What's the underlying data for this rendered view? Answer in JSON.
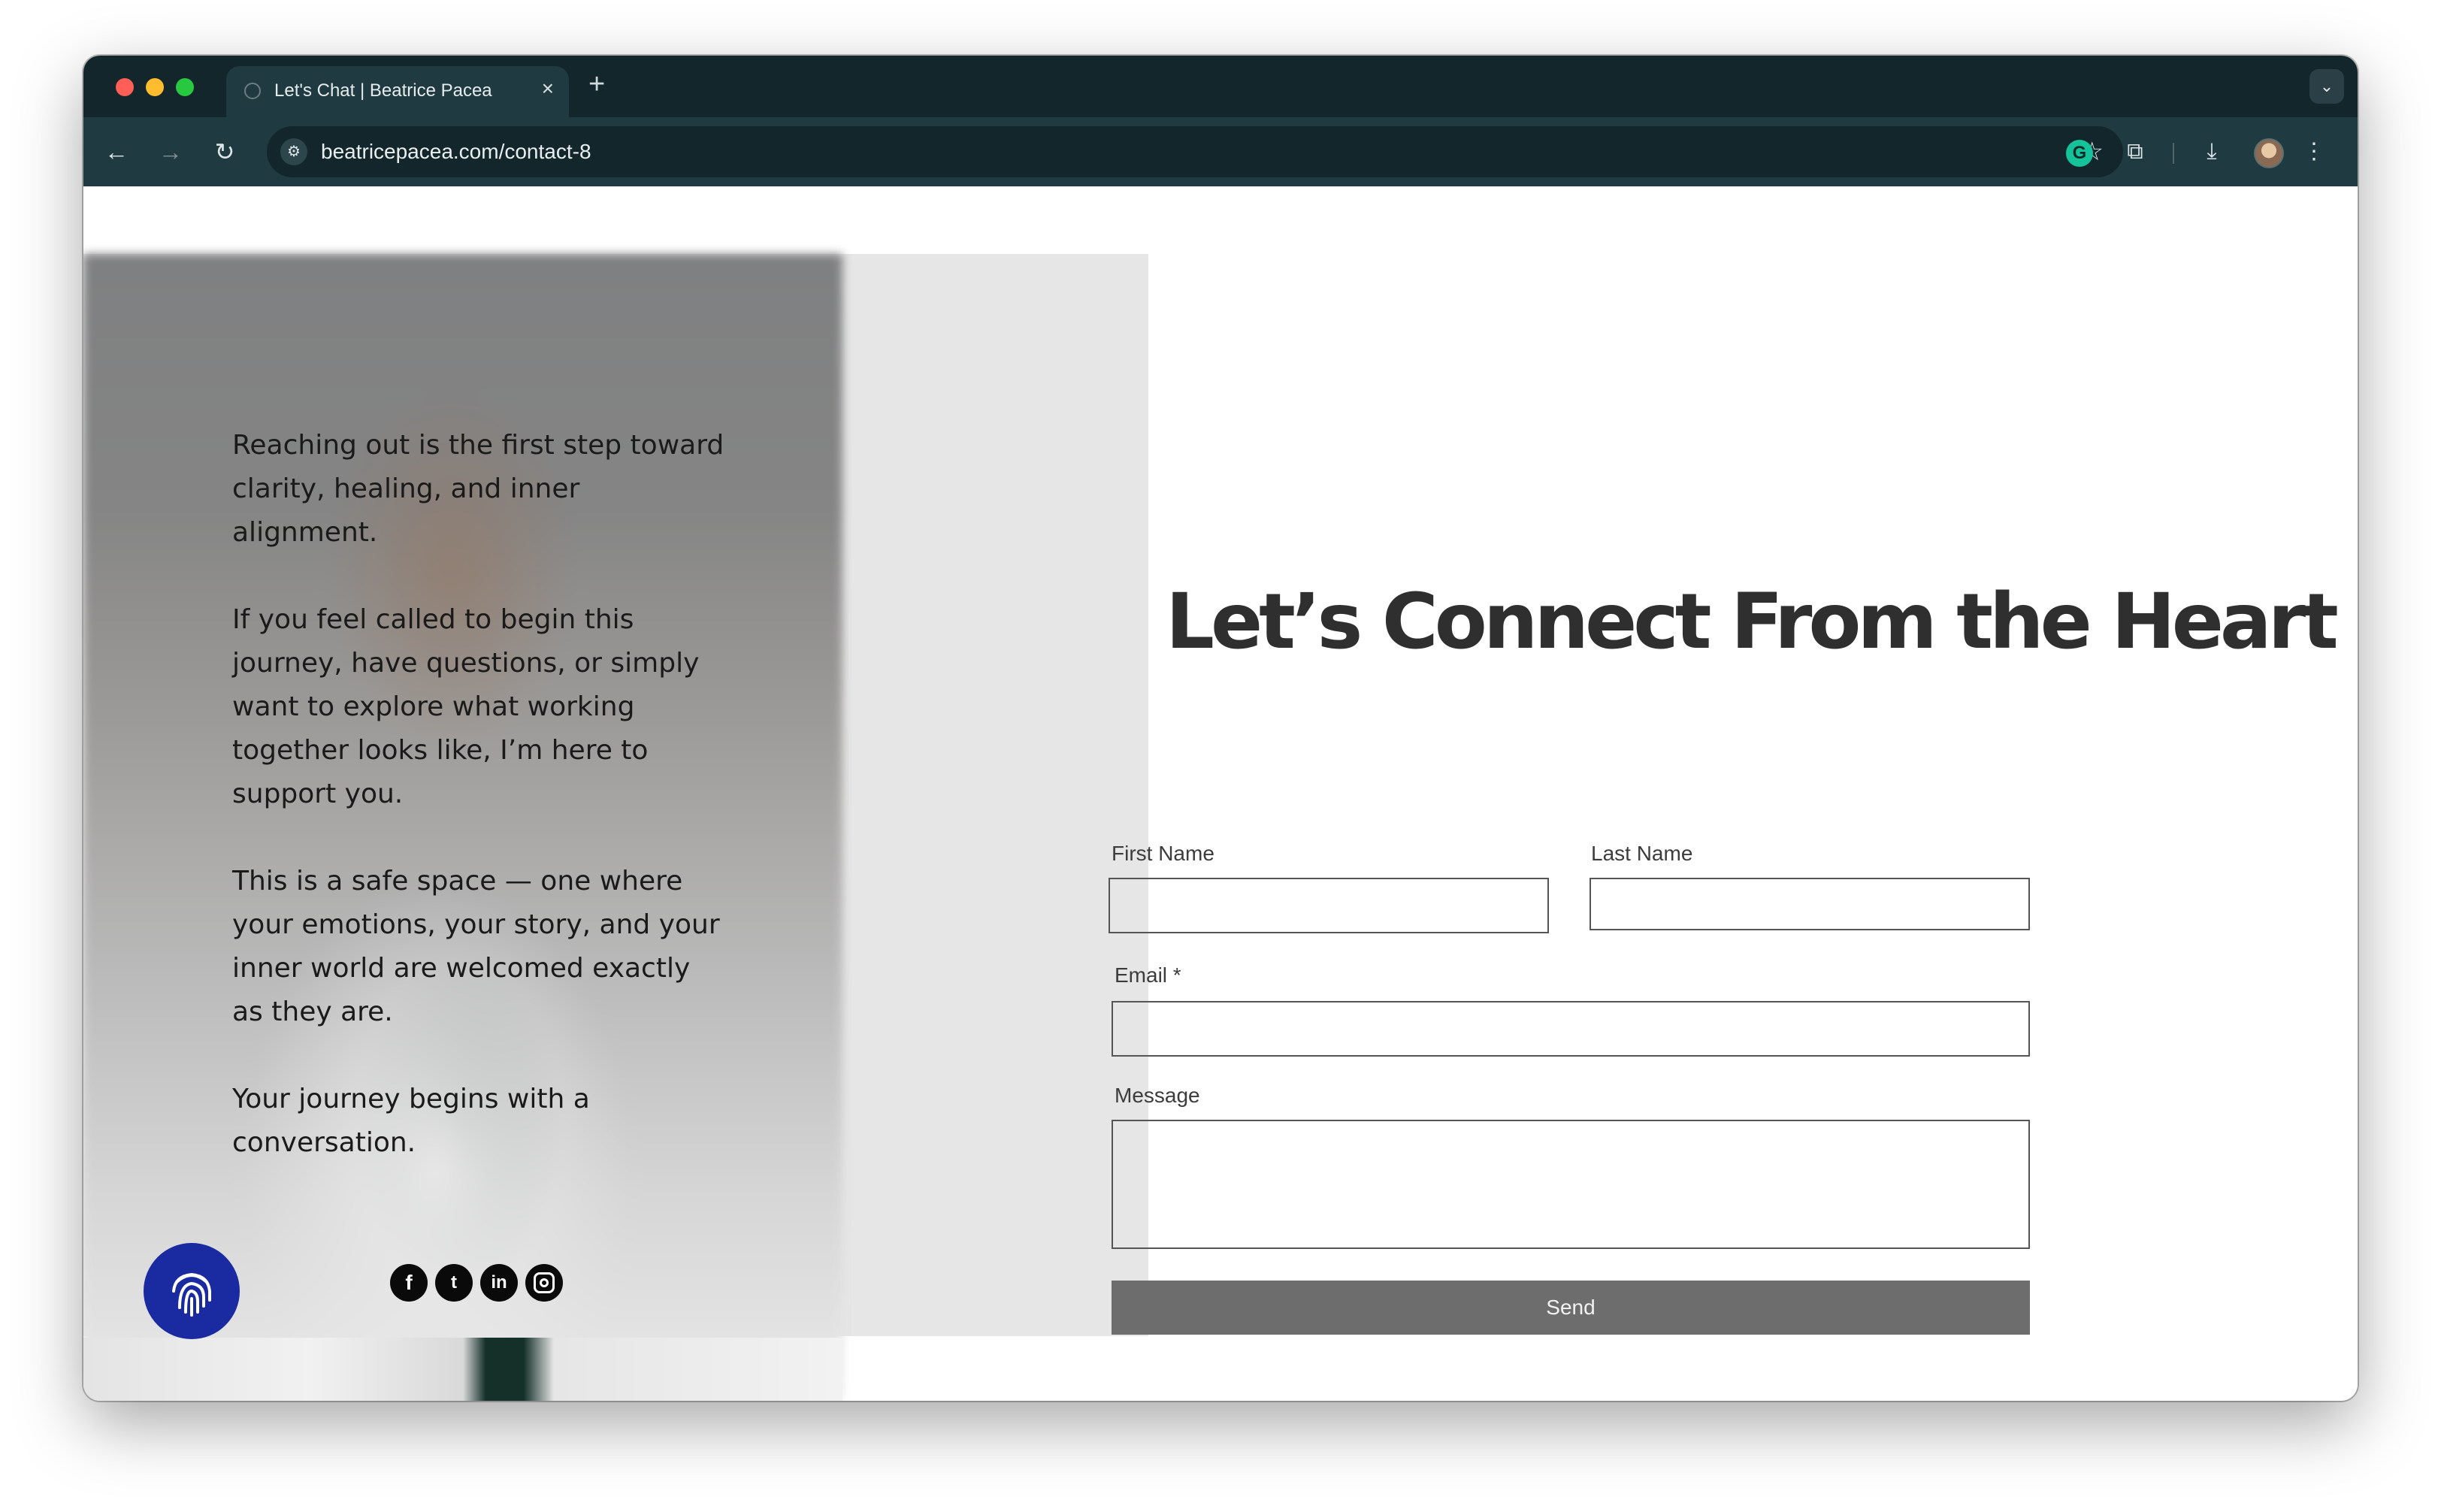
{
  "browser": {
    "tab_title": "Let's Chat | Beatrice Pacea",
    "tab_close": "×",
    "new_tab": "+",
    "tab_menu": "⌄",
    "url": "beatricepacea.com/contact-8",
    "icons": {
      "back": "←",
      "forward": "→",
      "reload": "↻",
      "site_info": "⚙",
      "bookmark": "☆",
      "grammarly": "G",
      "extensions": "⧉",
      "download": "⤓",
      "menu": "⋮"
    },
    "colors": {
      "titlebar": "#12262b",
      "toolbar": "#1f3a40"
    }
  },
  "page": {
    "intro_paragraphs": [
      "Reaching out is the first step toward clarity, healing, and inner alignment.",
      "If you feel called to begin this journey, have questions, or simply want to explore what working together looks like, I’m here to support you.",
      "This is a safe space — one where your emotions, your story, and your inner world are welcomed exactly as they are.",
      "Your journey begins with a conversation."
    ],
    "heading": "Let’s Connect From the Heart",
    "social": {
      "facebook": "f",
      "twitter": "t",
      "linkedin": "in"
    },
    "form": {
      "first_name_label": "First Name",
      "first_name_value": "",
      "last_name_label": "Last Name",
      "last_name_value": "",
      "email_label": "Email *",
      "email_value": "",
      "message_label": "Message",
      "message_value": "",
      "send_label": "Send"
    },
    "colors": {
      "accent_badge": "#1a2aa0",
      "send_button": "#6d6d6d",
      "panel": "#e6e6e6"
    }
  }
}
